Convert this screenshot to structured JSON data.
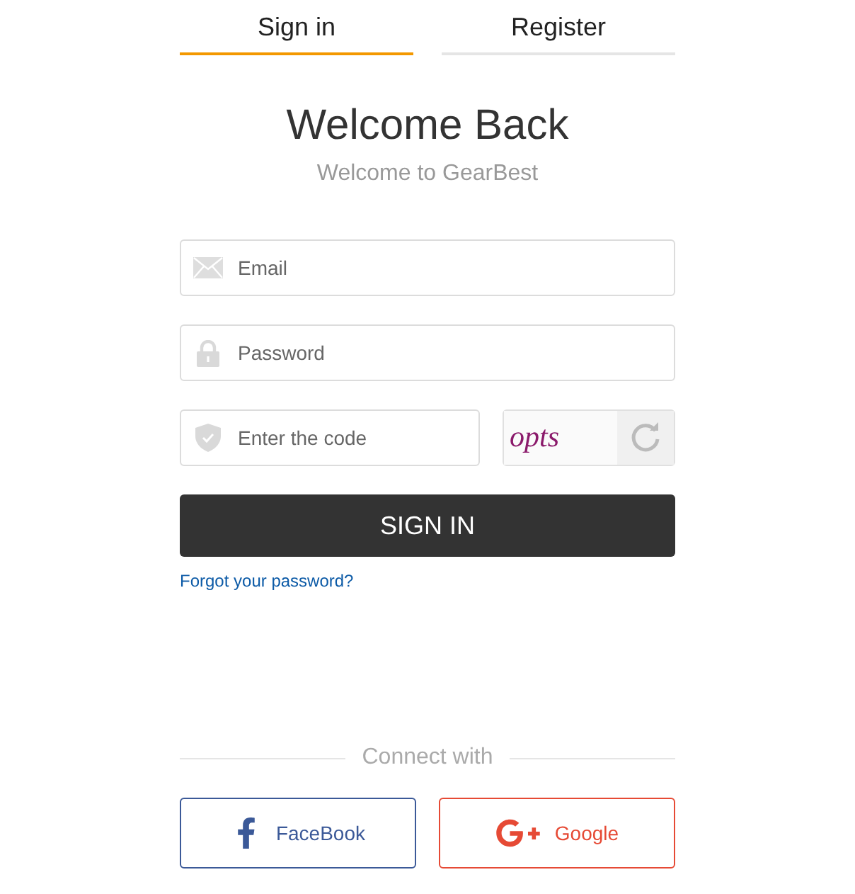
{
  "tabs": [
    {
      "label": "Sign in",
      "selected": true
    },
    {
      "label": "Register",
      "selected": false
    }
  ],
  "title": "Welcome Back",
  "subtitle": "Welcome to GearBest",
  "fields": [
    {
      "kind": "email",
      "placeholder": "Email"
    },
    {
      "kind": "password",
      "placeholder": "Password"
    }
  ],
  "code_field": {
    "placeholder": "Enter the code",
    "captcha": "opts"
  },
  "submit": "SIGN IN",
  "forgot_link": "Forgot your password?",
  "divider": "Connect with",
  "social": [
    {
      "kind": "facebook",
      "label": "FaceBook",
      "color": "#3b5998"
    },
    {
      "kind": "google",
      "label": "Google",
      "color": "#e64a35"
    }
  ]
}
